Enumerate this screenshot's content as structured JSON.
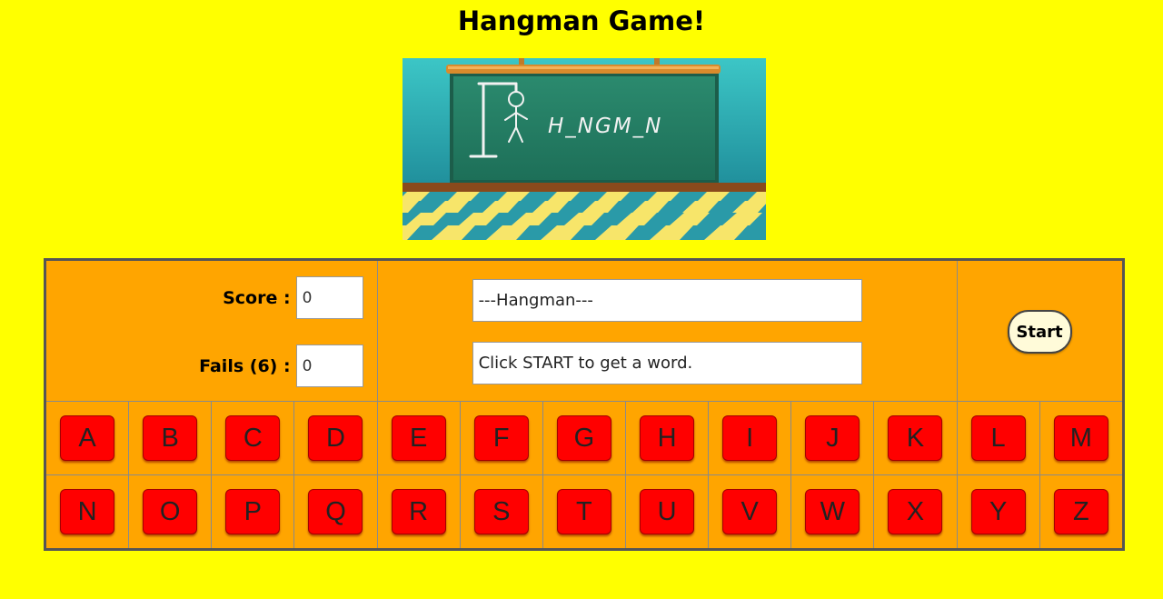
{
  "page": {
    "title": "Hangman Game!"
  },
  "banner": {
    "word_display": "H_NGM_N"
  },
  "stats": {
    "score_label": "Score :",
    "score_value": "0",
    "fails_label": "Fails (6) :",
    "fails_value": "0"
  },
  "word_area": {
    "word_value": "---Hangman---",
    "message_value": "Click START to get a word."
  },
  "controls": {
    "start_label": "Start"
  },
  "letters": {
    "row1": [
      "A",
      "B",
      "C",
      "D",
      "E",
      "F",
      "G",
      "H",
      "I",
      "J",
      "K",
      "L",
      "M"
    ],
    "row2": [
      "N",
      "O",
      "P",
      "Q",
      "R",
      "S",
      "T",
      "U",
      "V",
      "W",
      "X",
      "Y",
      "Z"
    ]
  },
  "colors": {
    "background": "#ffff00",
    "panel": "#ffa500",
    "letter_button": "#ff0000",
    "start_button": "#fffbd9"
  }
}
